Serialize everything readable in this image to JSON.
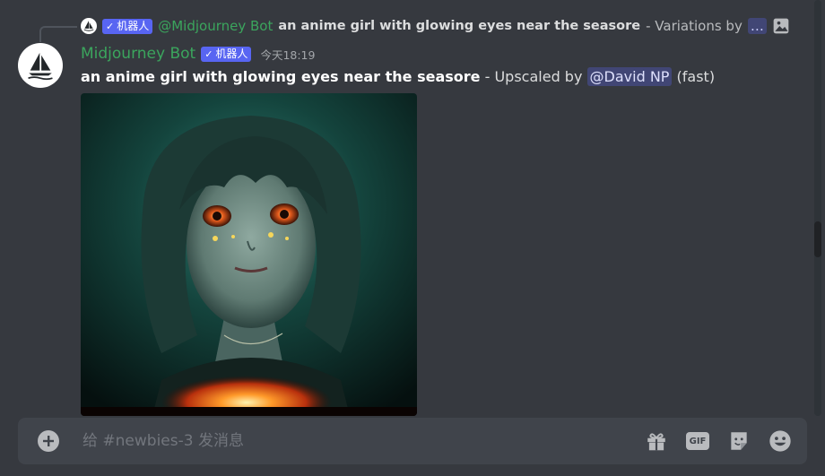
{
  "reply": {
    "badge_label": "机器人",
    "mention": "@Midjourney Bot",
    "prompt": "an anime girl with glowing eyes near the seasore",
    "suffix": "- Variations by",
    "more": "…"
  },
  "message": {
    "username": "Midjourney Bot",
    "badge_label": "机器人",
    "timestamp": "今天18:19",
    "prompt": "an anime girl with glowing eyes near the seasore",
    "suffix": "- Upscaled by",
    "mention": "@David NP",
    "speed": "(fast)"
  },
  "composer": {
    "placeholder": "给 #newbies-3 发消息",
    "gif_label": "GIF"
  },
  "colors": {
    "background": "#36393f",
    "bot_name": "#3ba55d",
    "badge": "#5865f2",
    "composer": "#40444b"
  }
}
